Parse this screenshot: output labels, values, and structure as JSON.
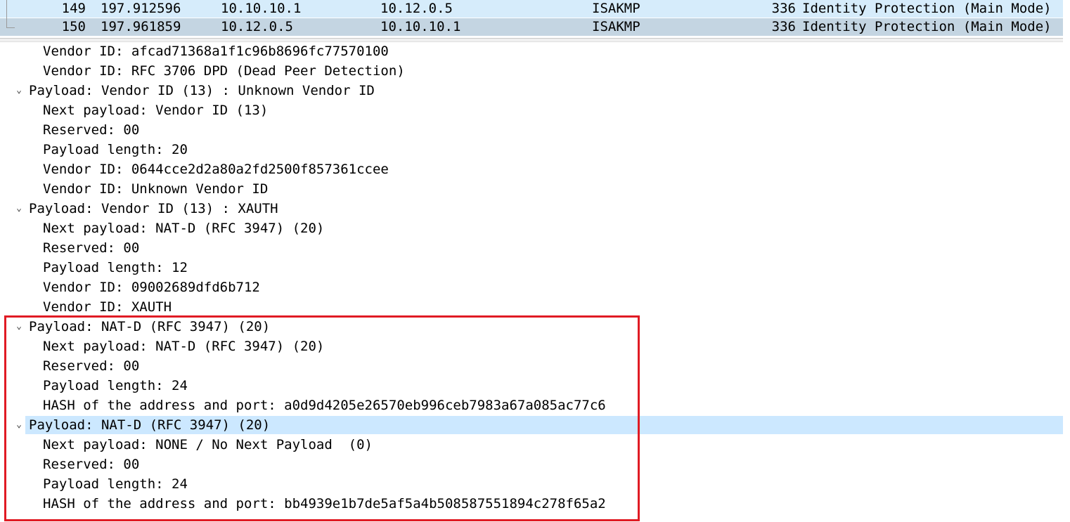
{
  "packet_list": {
    "rows": [
      {
        "no": "149",
        "time": "197.912596",
        "source": "10.10.10.1",
        "destination": "10.12.0.5",
        "protocol": "ISAKMP",
        "length": "336",
        "info": "Identity Protection (Main Mode)"
      },
      {
        "no": "150",
        "time": "197.961859",
        "source": "10.12.0.5",
        "destination": "10.10.10.1",
        "protocol": "ISAKMP",
        "length": "336",
        "info": "Identity Protection (Main Mode)"
      }
    ]
  },
  "details": {
    "expand_glyph": "⌄",
    "lines": [
      {
        "text": "Vendor ID: afcad71368a1f1c96b8696fc77570100",
        "level": 1,
        "expandable": false,
        "selected": false
      },
      {
        "text": "Vendor ID: RFC 3706 DPD (Dead Peer Detection)",
        "level": 1,
        "expandable": false,
        "selected": false
      },
      {
        "text": "Payload: Vendor ID (13) : Unknown Vendor ID",
        "level": 0,
        "expandable": true,
        "selected": false
      },
      {
        "text": "Next payload: Vendor ID (13)",
        "level": 1,
        "expandable": false,
        "selected": false
      },
      {
        "text": "Reserved: 00",
        "level": 1,
        "expandable": false,
        "selected": false
      },
      {
        "text": "Payload length: 20",
        "level": 1,
        "expandable": false,
        "selected": false
      },
      {
        "text": "Vendor ID: 0644cce2d2a80a2fd2500f857361ccee",
        "level": 1,
        "expandable": false,
        "selected": false
      },
      {
        "text": "Vendor ID: Unknown Vendor ID",
        "level": 1,
        "expandable": false,
        "selected": false
      },
      {
        "text": "Payload: Vendor ID (13) : XAUTH",
        "level": 0,
        "expandable": true,
        "selected": false
      },
      {
        "text": "Next payload: NAT-D (RFC 3947) (20)",
        "level": 1,
        "expandable": false,
        "selected": false
      },
      {
        "text": "Reserved: 00",
        "level": 1,
        "expandable": false,
        "selected": false
      },
      {
        "text": "Payload length: 12",
        "level": 1,
        "expandable": false,
        "selected": false
      },
      {
        "text": "Vendor ID: 09002689dfd6b712",
        "level": 1,
        "expandable": false,
        "selected": false
      },
      {
        "text": "Vendor ID: XAUTH",
        "level": 1,
        "expandable": false,
        "selected": false
      },
      {
        "text": "Payload: NAT-D (RFC 3947) (20)",
        "level": 0,
        "expandable": true,
        "selected": false
      },
      {
        "text": "Next payload: NAT-D (RFC 3947) (20)",
        "level": 1,
        "expandable": false,
        "selected": false
      },
      {
        "text": "Reserved: 00",
        "level": 1,
        "expandable": false,
        "selected": false
      },
      {
        "text": "Payload length: 24",
        "level": 1,
        "expandable": false,
        "selected": false
      },
      {
        "text": "HASH of the address and port: a0d9d4205e26570eb996ceb7983a67a085ac77c6",
        "level": 1,
        "expandable": false,
        "selected": false
      },
      {
        "text": "Payload: NAT-D (RFC 3947) (20)",
        "level": 0,
        "expandable": true,
        "selected": true
      },
      {
        "text": "Next payload: NONE / No Next Payload  (0)",
        "level": 1,
        "expandable": false,
        "selected": false
      },
      {
        "text": "Reserved: 00",
        "level": 1,
        "expandable": false,
        "selected": false
      },
      {
        "text": "Payload length: 24",
        "level": 1,
        "expandable": false,
        "selected": false
      },
      {
        "text": "HASH of the address and port: bb4939e1b7de5af5a4b508587551894c278f65a2",
        "level": 1,
        "expandable": false,
        "selected": false
      }
    ]
  },
  "colors": {
    "highlight_box": "#e01b24",
    "selected_row": "#cce8ff",
    "packet_row_1": "#d6ecfb",
    "packet_row_2": "#c4d5e2"
  }
}
